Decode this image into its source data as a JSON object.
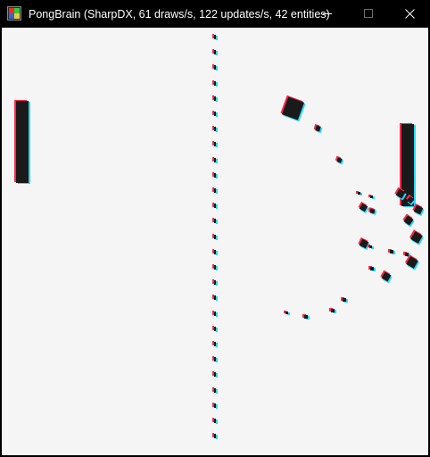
{
  "window": {
    "title": "PongBrain (SharpDX, 61 draws/s, 122 updates/s, 42 entities)",
    "controls": {
      "minimize_icon": "minimize-icon",
      "maximize_icon": "maximize-icon",
      "close_icon": "close-icon"
    }
  },
  "colors": {
    "titlebar": "#000000",
    "title_text": "#ffffff",
    "play_area": "#f5f5f5",
    "entity": "#1a1a1a",
    "fringe_red": "#ff2a4a",
    "fringe_cyan": "#2ad8ff"
  },
  "game": {
    "entity_count": 42,
    "draws_per_second": 61,
    "updates_per_second": 122
  }
}
